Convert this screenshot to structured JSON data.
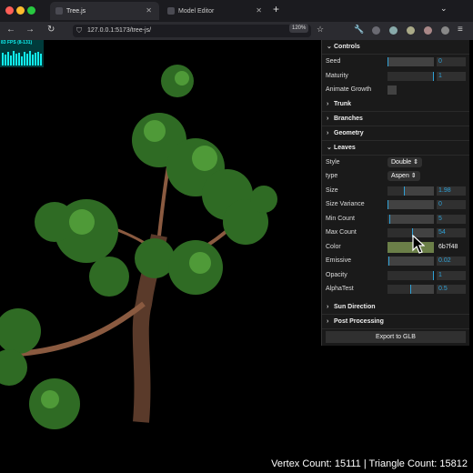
{
  "browser": {
    "tabs": [
      {
        "label": "Tree.js",
        "active": true
      },
      {
        "label": "Model Editor",
        "active": false
      }
    ],
    "url": "127.0.0.1:5173/tree-js/",
    "zoom": "120%"
  },
  "viewport": {
    "fps_label": "83 FPS (8-131)",
    "stats": "Vertex Count: 15111 | Triangle Count: 15812"
  },
  "gui": {
    "controls": {
      "title": "Controls",
      "seed": {
        "label": "Seed",
        "value": "0",
        "fraction": 0.0
      },
      "maturity": {
        "label": "Maturity",
        "value": "1",
        "fraction": 1.0
      },
      "animate": {
        "label": "Animate Growth",
        "checked": false
      }
    },
    "trunk": "Trunk",
    "branches": "Branches",
    "geometry": "Geometry",
    "leaves": {
      "title": "Leaves",
      "style": {
        "label": "Style",
        "value": "Double"
      },
      "type": {
        "label": "type",
        "value": "Aspen"
      },
      "size": {
        "label": "Size",
        "value": "1.98",
        "fraction": 0.36
      },
      "size_variance": {
        "label": "Size Variance",
        "value": "0",
        "fraction": 0.0
      },
      "min_count": {
        "label": "Min Count",
        "value": "5",
        "fraction": 0.05
      },
      "max_count": {
        "label": "Max Count",
        "value": "54",
        "fraction": 0.54
      },
      "color": {
        "label": "Color",
        "value": "6b7f48",
        "hex": "#6b7f48"
      },
      "emissive": {
        "label": "Emissive",
        "value": "0.02",
        "fraction": 0.02
      },
      "opacity": {
        "label": "Opacity",
        "value": "1",
        "fraction": 1.0
      },
      "alphatest": {
        "label": "AlphaTest",
        "value": "0.5",
        "fraction": 0.5
      }
    },
    "sun_direction": "Sun Direction",
    "post_processing": "Post Processing",
    "export_label": "Export to GLB"
  }
}
